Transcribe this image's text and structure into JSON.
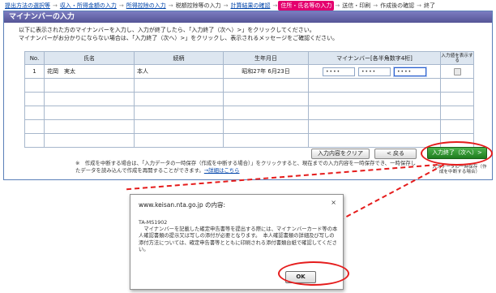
{
  "steps": [
    {
      "label": "提出方法の選択等",
      "state": "link"
    },
    {
      "label": "収入・所得金額の入力",
      "state": "link"
    },
    {
      "label": "所得控除の入力",
      "state": "link"
    },
    {
      "label": "税額控除等の入力",
      "state": "plain"
    },
    {
      "label": "計算結果の確認",
      "state": "link"
    },
    {
      "label": "住所・氏名等の入力",
      "state": "active"
    },
    {
      "label": "送信・印刷",
      "state": "plain"
    },
    {
      "label": "作成後の確認",
      "state": "plain"
    },
    {
      "label": "終了",
      "state": "plain"
    }
  ],
  "page_title": "マイナンバーの入力",
  "instructions": [
    "以下に表示された方のマイナンバーを入力し、入力が終了したら、「入力終了（次へ）>」をクリックしてください。",
    "マイナンバーがお分かりにならない場合は、「入力終了（次へ）>」をクリックし、表示されるメッセージをご確認ください。"
  ],
  "table": {
    "headers": [
      "No.",
      "氏名",
      "続柄",
      "生年月日",
      "マイナンバー[各半角数字4桁]",
      "入力値を表示する"
    ],
    "rows": [
      {
        "no": "1",
        "name": "花岡　実太",
        "relation": "本人",
        "birth": "昭和27年 6月23日",
        "mynumber": [
          "••••",
          "••••",
          "••••"
        ]
      }
    ],
    "empty_rows": 5
  },
  "buttons": {
    "clear": "入力内容をクリア",
    "back": "< 戻る",
    "finish": "入力終了（次へ）>",
    "save_caption": "入力データの一時保存（作成を中断する場合）"
  },
  "note": {
    "text": "※　作成を中断する場合は、「入力データの一時保存（作成を中断する場合）」をクリックすると、現在までの入力内容を一時保存でき、一時保存したデータを読み込んで作成を再開することができます。",
    "link": "→詳細はこちら"
  },
  "dialog": {
    "title": "www.keisan.nta.go.jp の内容:",
    "close": "×",
    "code": "TA-MS1902",
    "message": "　マイナンバーを記載した確定申告書等を提出する際には、マイナンバーカード等の本人確認書類の提示又は写しの添付が必要となります。　本人確認書類の詳細及び写しの添付方法については、確定申告書等とともに印刷される添付書類台紙で確認してください。",
    "ok": "OK"
  },
  "colors": {
    "title_bar": "#555596",
    "active_step": "#e4006e",
    "finish_button": "#1f7d1f",
    "highlight": "#e51c1c",
    "link": "#0044aa"
  }
}
